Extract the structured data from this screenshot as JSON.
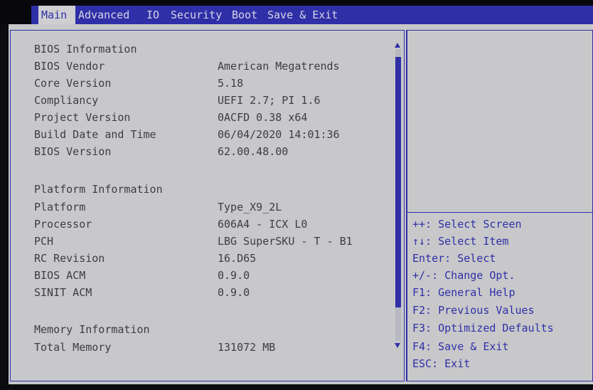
{
  "menu": {
    "tabs": [
      {
        "label": "Main"
      },
      {
        "label": "Advanced"
      },
      {
        "label": "IO"
      },
      {
        "label": "Security"
      },
      {
        "label": "Boot"
      },
      {
        "label": "Save & Exit"
      }
    ],
    "active": "Main"
  },
  "bios": {
    "section_title": "BIOS Information",
    "rows": [
      {
        "label": "BIOS Vendor",
        "value": "American Megatrends"
      },
      {
        "label": "Core Version",
        "value": "5.18"
      },
      {
        "label": "Compliancy",
        "value": "UEFI 2.7; PI 1.6"
      },
      {
        "label": "Project Version",
        "value": "0ACFD 0.38 x64"
      },
      {
        "label": "Build Date and Time",
        "value": "06/04/2020 14:01:36"
      },
      {
        "label": "BIOS Version",
        "value": "62.00.48.00"
      }
    ]
  },
  "platform": {
    "section_title": "Platform Information",
    "rows": [
      {
        "label": "Platform",
        "value": "Type_X9_2L"
      },
      {
        "label": "Processor",
        "value": "606A4 - ICX L0"
      },
      {
        "label": "PCH",
        "value": "LBG SuperSKU - T - B1"
      },
      {
        "label": "RC Revision",
        "value": "16.D65"
      },
      {
        "label": "BIOS ACM",
        "value": "0.9.0"
      },
      {
        "label": "SINIT ACM",
        "value": "0.9.0"
      }
    ]
  },
  "memory": {
    "section_title": "Memory Information",
    "rows": [
      {
        "label": "Total Memory",
        "value": "131072 MB"
      }
    ]
  },
  "help": {
    "items": [
      "++: Select Screen",
      "↑↓: Select Item",
      "Enter: Select",
      "+/-: Change Opt.",
      "F1: General Help",
      "F2: Previous Values",
      "F3: Optimized Defaults",
      "F4: Save & Exit",
      "ESC: Exit"
    ]
  },
  "colors": {
    "accent": "#2f2fa8",
    "background": "#c8c8ca",
    "text": "#3c3c44"
  }
}
